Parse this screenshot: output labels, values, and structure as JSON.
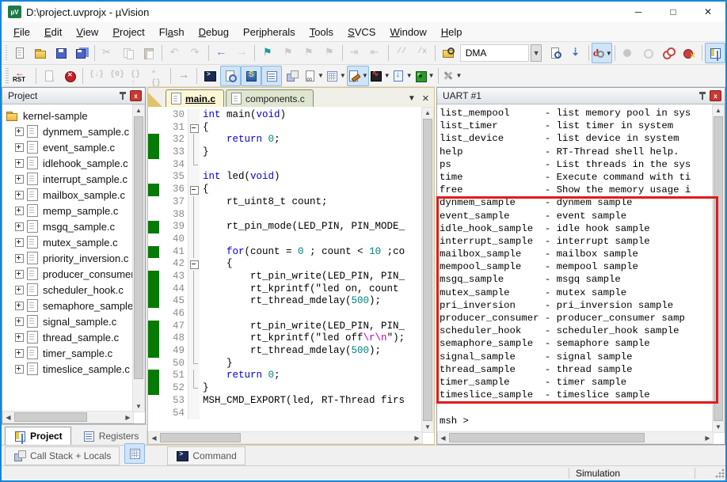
{
  "window": {
    "title": "D:\\project.uvprojx - µVision",
    "controls": {
      "minimize": "─",
      "maximize": "□",
      "close": "✕"
    }
  },
  "menu": {
    "items": [
      {
        "label": "File",
        "accel": 0
      },
      {
        "label": "Edit",
        "accel": 0
      },
      {
        "label": "View",
        "accel": 0
      },
      {
        "label": "Project",
        "accel": 0
      },
      {
        "label": "Flash",
        "accel": 2
      },
      {
        "label": "Debug",
        "accel": 0
      },
      {
        "label": "Peripherals",
        "accel": 3
      },
      {
        "label": "Tools",
        "accel": 0
      },
      {
        "label": "SVCS",
        "accel": 0
      },
      {
        "label": "Window",
        "accel": 0
      },
      {
        "label": "Help",
        "accel": 0
      }
    ]
  },
  "toolbar1": {
    "combo_value": "DMA",
    "buttons": [
      {
        "name": "new-file-button",
        "icon": "page"
      },
      {
        "name": "open-file-button",
        "icon": "folder"
      },
      {
        "name": "save-button",
        "icon": "save"
      },
      {
        "name": "save-all-button",
        "icon": "saveall"
      },
      {
        "sep": true
      },
      {
        "name": "cut-button",
        "icon": "cut",
        "disabled": true
      },
      {
        "name": "copy-button",
        "icon": "copy",
        "disabled": true
      },
      {
        "name": "paste-button",
        "icon": "paste",
        "disabled": true
      },
      {
        "sep": true
      },
      {
        "name": "undo-button",
        "icon": "undo",
        "disabled": true
      },
      {
        "name": "redo-button",
        "icon": "redo",
        "disabled": true
      },
      {
        "sep": true
      },
      {
        "name": "navigate-back-button",
        "icon": "back"
      },
      {
        "name": "navigate-forward-button",
        "icon": "fwd",
        "disabled": true
      },
      {
        "sep": true
      },
      {
        "name": "bookmark-toggle-button",
        "icon": "flag"
      },
      {
        "name": "bookmark-next-button",
        "icon": "flaggray",
        "disabled": true
      },
      {
        "name": "bookmark-prev-button",
        "icon": "flaggray",
        "disabled": true
      },
      {
        "name": "bookmark-clear-button",
        "icon": "flaggray",
        "disabled": true
      },
      {
        "sep": true
      },
      {
        "name": "indent-button",
        "icon": "indent",
        "disabled": true
      },
      {
        "name": "unindent-button",
        "icon": "outdent",
        "disabled": true
      },
      {
        "sep": true
      },
      {
        "name": "comment-button",
        "icon": "comment",
        "disabled": true
      },
      {
        "name": "uncomment-button",
        "icon": "uncomment",
        "disabled": true
      },
      {
        "sep": true
      },
      {
        "name": "find-in-files-button",
        "icon": "findfolder"
      },
      {
        "combo": true
      },
      {
        "name": "combo-dropdown-button",
        "dropbtn": true
      },
      {
        "name": "find-in-files-dialog-button",
        "icon": "finddoc"
      },
      {
        "name": "incremental-find-button",
        "icon": "findinc"
      },
      {
        "sep": true
      },
      {
        "name": "start-stop-debug-button",
        "icon": "debugd",
        "active": true,
        "caret": true
      },
      {
        "sep": true
      },
      {
        "name": "insert-breakpoint-button",
        "icon": "bpfill",
        "disabled": true
      },
      {
        "name": "enable-breakpoint-button",
        "icon": "bpoutline",
        "disabled": true
      },
      {
        "name": "disable-all-breakpoints-button",
        "icon": "bpdisable"
      },
      {
        "name": "kill-all-breakpoints-button",
        "icon": "bpkill"
      },
      {
        "sep": true
      },
      {
        "name": "project-window-button",
        "icon": "projwin",
        "active": true
      }
    ]
  },
  "toolbar2": {
    "buttons": [
      {
        "name": "reset-button",
        "icon": "rst"
      },
      {
        "sep": true
      },
      {
        "name": "run-button",
        "icon": "rundoc",
        "disabled": true
      },
      {
        "name": "stop-button",
        "icon": "stopx"
      },
      {
        "sep": true
      },
      {
        "name": "step-button",
        "icon": "step1",
        "disabled": true
      },
      {
        "name": "step-over-button",
        "icon": "step2",
        "disabled": true
      },
      {
        "name": "step-out-button",
        "icon": "step3",
        "disabled": true
      },
      {
        "name": "run-to-line-button",
        "icon": "step4",
        "disabled": true
      },
      {
        "sep": true
      },
      {
        "name": "show-next-statement-button",
        "icon": "goarrow"
      },
      {
        "sep": true
      },
      {
        "name": "command-window-button",
        "icon": "console"
      },
      {
        "name": "disassembly-window-button",
        "icon": "disasm",
        "active": true
      },
      {
        "name": "symbol-window-button",
        "icon": "symbols",
        "active": true
      },
      {
        "name": "registers-window-button",
        "icon": "reglines",
        "active": true
      },
      {
        "name": "call-stack-window-button",
        "icon": "callstack"
      },
      {
        "name": "watch-window-button",
        "icon": "watch",
        "caret": true
      },
      {
        "name": "memory-window-button",
        "icon": "memgrid",
        "caret": true
      },
      {
        "name": "serial-window-button",
        "icon": "serial",
        "active": true,
        "caret": true
      },
      {
        "name": "analysis-window-button",
        "icon": "analysis",
        "caret": true
      },
      {
        "name": "trace-window-button",
        "icon": "trace",
        "caret": true
      },
      {
        "name": "system-viewer-button",
        "icon": "sysview",
        "caret": true
      },
      {
        "sep": true
      },
      {
        "name": "toolbox-button",
        "icon": "tools",
        "caret": true
      }
    ]
  },
  "project": {
    "title": "Project",
    "root": "kernel-sample",
    "files": [
      "dynmem_sample.c",
      "event_sample.c",
      "idlehook_sample.c",
      "interrupt_sample.c",
      "mailbox_sample.c",
      "memp_sample.c",
      "msgq_sample.c",
      "mutex_sample.c",
      "priority_inversion.c",
      "producer_consumer.c",
      "scheduler_hook.c",
      "semaphore_sample.c",
      "signal_sample.c",
      "thread_sample.c",
      "timer_sample.c",
      "timeslice_sample.c"
    ],
    "tabs": [
      {
        "label": "Project",
        "active": true,
        "icon": "projwin"
      },
      {
        "label": "Registers",
        "active": false,
        "icon": "reglines"
      }
    ]
  },
  "editor": {
    "tabs": [
      {
        "label": "main.c",
        "active": true
      },
      {
        "label": "components.c",
        "active": false
      }
    ],
    "green_color": "#067a06",
    "lines": [
      {
        "n": 30,
        "g": false,
        "f": "",
        "s": [
          [
            "kw",
            "int"
          ],
          [
            "pl",
            " main("
          ],
          [
            "kw",
            "void"
          ],
          [
            "pl",
            ")"
          ]
        ]
      },
      {
        "n": 31,
        "g": false,
        "f": "box",
        "s": [
          [
            "pl",
            "{"
          ]
        ]
      },
      {
        "n": 32,
        "g": true,
        "f": "v",
        "s": [
          [
            "pl",
            "    "
          ],
          [
            "kw",
            "return"
          ],
          [
            "pl",
            " "
          ],
          [
            "num",
            "0"
          ],
          [
            "pl",
            ";"
          ]
        ]
      },
      {
        "n": 33,
        "g": true,
        "f": "v",
        "s": [
          [
            "pl",
            "}"
          ]
        ]
      },
      {
        "n": 34,
        "g": false,
        "f": "end",
        "s": []
      },
      {
        "n": 35,
        "g": false,
        "f": "",
        "s": [
          [
            "kw",
            "int"
          ],
          [
            "pl",
            " led("
          ],
          [
            "kw",
            "void"
          ],
          [
            "pl",
            ")"
          ]
        ]
      },
      {
        "n": 36,
        "g": true,
        "f": "box",
        "s": [
          [
            "pl",
            "{"
          ]
        ]
      },
      {
        "n": 37,
        "g": false,
        "f": "v",
        "s": [
          [
            "pl",
            "    rt_uint8_t count;"
          ]
        ]
      },
      {
        "n": 38,
        "g": false,
        "f": "v",
        "s": []
      },
      {
        "n": 39,
        "g": true,
        "f": "v",
        "s": [
          [
            "pl",
            "    rt_pin_mode(LED_PIN, PIN_MODE_"
          ]
        ]
      },
      {
        "n": 40,
        "g": false,
        "f": "v",
        "s": []
      },
      {
        "n": 41,
        "g": true,
        "f": "v",
        "s": [
          [
            "pl",
            "    "
          ],
          [
            "kw",
            "for"
          ],
          [
            "pl",
            "(count = "
          ],
          [
            "num",
            "0"
          ],
          [
            "pl",
            " ; count < "
          ],
          [
            "num",
            "10"
          ],
          [
            "pl",
            " ;co"
          ]
        ]
      },
      {
        "n": 42,
        "g": false,
        "f": "box",
        "s": [
          [
            "pl",
            "    {"
          ]
        ]
      },
      {
        "n": 43,
        "g": true,
        "f": "v",
        "s": [
          [
            "pl",
            "        rt_pin_write(LED_PIN, PIN_"
          ]
        ]
      },
      {
        "n": 44,
        "g": true,
        "f": "v",
        "s": [
          [
            "pl",
            "        rt_kprintf("
          ],
          [
            "str",
            "\"led on, count"
          ]
        ]
      },
      {
        "n": 45,
        "g": true,
        "f": "v",
        "s": [
          [
            "pl",
            "        rt_thread_mdelay("
          ],
          [
            "num",
            "500"
          ],
          [
            "pl",
            ");"
          ]
        ]
      },
      {
        "n": 46,
        "g": false,
        "f": "v",
        "s": []
      },
      {
        "n": 47,
        "g": true,
        "f": "v",
        "s": [
          [
            "pl",
            "        rt_pin_write(LED_PIN, PIN_"
          ]
        ]
      },
      {
        "n": 48,
        "g": true,
        "f": "v",
        "s": [
          [
            "pl",
            "        rt_kprintf("
          ],
          [
            "str",
            "\"led off"
          ],
          [
            "esc",
            "\\r\\n"
          ],
          [
            "str",
            "\""
          ],
          [
            "pl",
            ");"
          ]
        ]
      },
      {
        "n": 49,
        "g": true,
        "f": "v",
        "s": [
          [
            "pl",
            "        rt_thread_mdelay("
          ],
          [
            "num",
            "500"
          ],
          [
            "pl",
            ");"
          ]
        ]
      },
      {
        "n": 50,
        "g": false,
        "f": "end",
        "s": [
          [
            "pl",
            "    }"
          ]
        ]
      },
      {
        "n": 51,
        "g": true,
        "f": "v",
        "s": [
          [
            "pl",
            "    "
          ],
          [
            "kw",
            "return"
          ],
          [
            "pl",
            " "
          ],
          [
            "num",
            "0"
          ],
          [
            "pl",
            ";"
          ]
        ]
      },
      {
        "n": 52,
        "g": true,
        "f": "end",
        "s": [
          [
            "pl",
            "}"
          ]
        ]
      },
      {
        "n": 53,
        "g": false,
        "f": "",
        "s": [
          [
            "pl",
            "MSH_CMD_EXPORT(led, RT-Thread firs"
          ]
        ]
      },
      {
        "n": 54,
        "g": false,
        "f": "",
        "s": []
      }
    ]
  },
  "uart": {
    "title": "UART #1",
    "lines": [
      "list_mempool      - list memory pool in sys",
      "list_timer        - list timer in system",
      "list_device       - list device in system",
      "help              - RT-Thread shell help.",
      "ps                - List threads in the sys",
      "time              - Execute command with ti",
      "free              - Show the memory usage i",
      "dynmem_sample     - dynmem sample",
      "event_sample      - event sample",
      "idle_hook_sample  - idle hook sample",
      "interrupt_sample  - interrupt sample",
      "mailbox_sample    - mailbox sample",
      "mempool_sample    - mempool sample",
      "msgq_sample       - msgq sample",
      "mutex_sample      - mutex sample",
      "pri_inversion     - pri_inversion sample",
      "producer_consumer - producer_consumer samp",
      "scheduler_hook    - scheduler_hook sample",
      "semaphore_sample  - semaphore sample",
      "signal_sample     - signal sample",
      "thread_sample     - thread sample",
      "timer_sample      - timer sample",
      "timeslice_sample  - timeslice sample",
      "",
      "msh >"
    ],
    "annotation_color": "#e01b1c"
  },
  "bottom": {
    "call_stack_label": "Call Stack + Locals",
    "command_label": "Command"
  },
  "status": {
    "simulation": "Simulation"
  }
}
